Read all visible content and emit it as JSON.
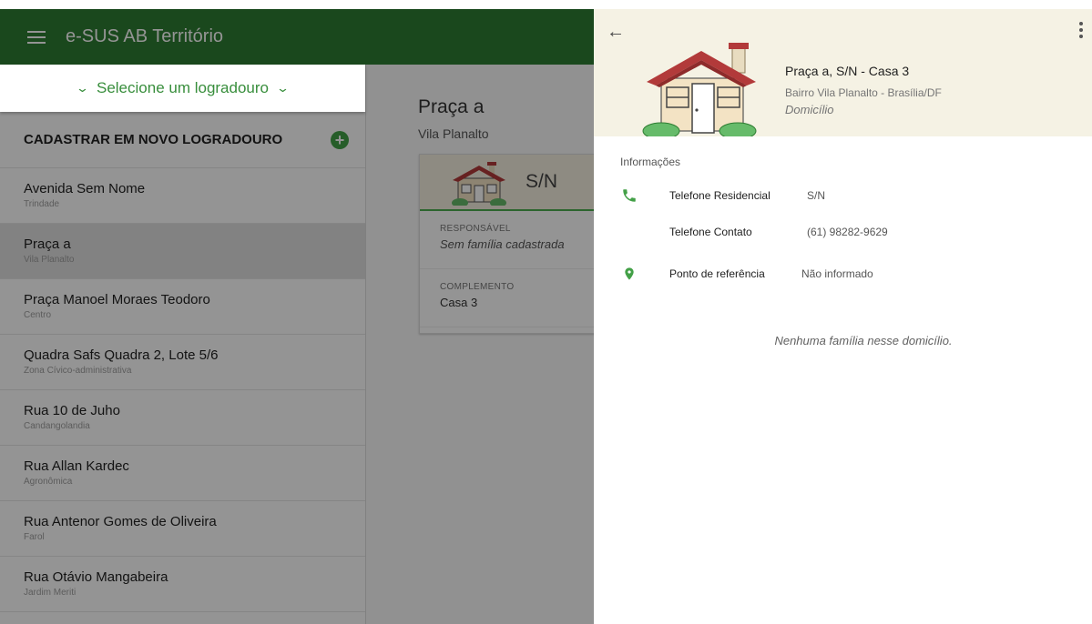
{
  "app": {
    "title": "e-SUS AB Território",
    "colors": {
      "appbar": "#2e7d32",
      "accent": "#43a047",
      "panel_header": "#f5f2e4"
    }
  },
  "left": {
    "selector_label": "Selecione um logradouro",
    "new_label": "CADASTRAR EM NOVO LOGRADOURO",
    "streets": [
      {
        "name": "Avenida Sem Nome",
        "district": "Trindade"
      },
      {
        "name": "Praça a",
        "district": "Vila Planalto"
      },
      {
        "name": "Praça Manoel Moraes Teodoro",
        "district": "Centro"
      },
      {
        "name": "Quadra Safs Quadra 2, Lote 5/6",
        "district": "Zona Cívico-administrativa"
      },
      {
        "name": "Rua 10 de Juho",
        "district": "Candangolandia"
      },
      {
        "name": "Rua Allan Kardec",
        "district": "Agronômica"
      },
      {
        "name": "Rua Antenor Gomes de Oliveira",
        "district": "Farol"
      },
      {
        "name": "Rua Otávio Mangabeira",
        "district": "Jardim Meriti"
      }
    ]
  },
  "middle": {
    "street_title": "Praça a",
    "street_district": "Vila Planalto",
    "card": {
      "number": "S/N",
      "responsavel_label": "RESPONSÁVEL",
      "responsavel_value": "Sem família cadastrada",
      "complemento_label": "COMPLEMENTO",
      "complemento_value": "Casa 3"
    }
  },
  "panel": {
    "title": "Praça a, S/N - Casa 3",
    "subtitle": "Bairro Vila Planalto - Brasília/DF",
    "type": "Domicílio",
    "info_header": "Informações",
    "phone_res_label": "Telefone Residencial",
    "phone_res_value": "S/N",
    "phone_contact_label": "Telefone Contato",
    "phone_contact_value": "(61) 98282-9629",
    "reference_label": "Ponto de referência",
    "reference_value": "Não informado",
    "empty_message": "Nenhuma família nesse domicílio."
  }
}
